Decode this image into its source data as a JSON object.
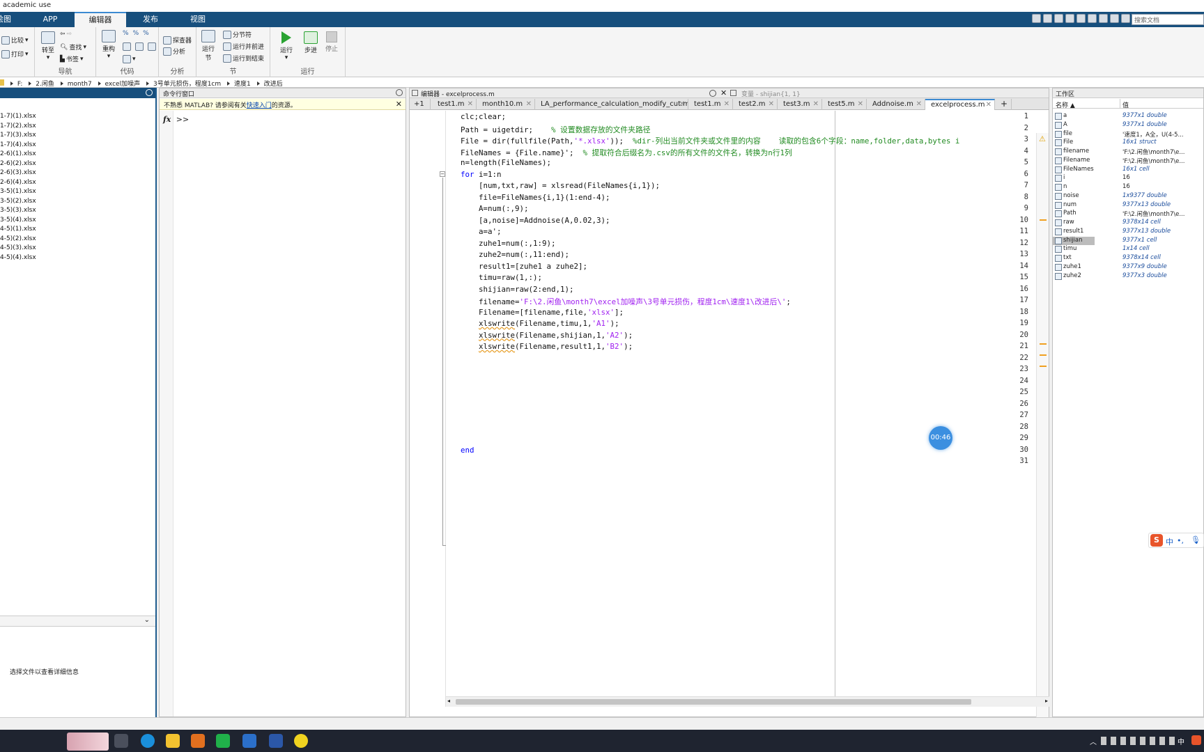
{
  "window": {
    "title": "academic use"
  },
  "ribbon_tabs": [
    {
      "label": "绘图"
    },
    {
      "label": "APP"
    },
    {
      "label": "编辑器"
    },
    {
      "label": "发布"
    },
    {
      "label": "视图"
    }
  ],
  "search": {
    "placeholder": "搜索文档"
  },
  "ribbon": {
    "compare": "比较",
    "print": "打印",
    "goto": "转至",
    "find": "查找",
    "bookmark": "书签",
    "nav_group": "导航",
    "refactor": "重构",
    "code_group": "代码",
    "profiler": "探查器",
    "analyze": "分析",
    "analyze_group": "分析",
    "run_section": "运行\n节",
    "section_break": "分节符",
    "run_and_advance": "运行并前进",
    "run_to_end": "运行到结束",
    "section_group": "节",
    "run": "运行",
    "step": "步进",
    "stop": "停止",
    "run_group": "运行"
  },
  "address": {
    "crumbs": [
      "F:",
      "2.闲鱼",
      "month7",
      "excel加噪声",
      "3号单元损伤，程度1cm",
      "速度1",
      "改进后"
    ]
  },
  "files": [
    "1-7)(1).xlsx",
    "1-7)(2).xlsx",
    "1-7)(3).xlsx",
    "1-7)(4).xlsx",
    "2-6)(1).xlsx",
    "2-6)(2).xlsx",
    "2-6)(3).xlsx",
    "2-6)(4).xlsx",
    "3-5)(1).xlsx",
    "3-5)(2).xlsx",
    "3-5)(3).xlsx",
    "3-5)(4).xlsx",
    "4-5)(1).xlsx",
    "4-5)(2).xlsx",
    "4-5)(3).xlsx",
    "4-5)(4).xlsx"
  ],
  "details": {
    "hint": "选择文件以查看详细信息"
  },
  "command_window": {
    "title": "命令行窗口",
    "notice_prefix": "不熟悉 MATLAB? 请参阅有关",
    "notice_link": "快速入门",
    "notice_suffix": "的资源。",
    "fx": "fx",
    "prompt": ">>"
  },
  "editor": {
    "title": "编辑器 - excelprocess.m",
    "variable_title": "变量 - shijian{1, 1}",
    "tab_counter": "+1",
    "tabs": [
      "test1.m",
      "month10.m",
      "LA_performance_calculation_modify_cut.m",
      "test1.m",
      "test2.m",
      "test3.m",
      "test5.m",
      "Addnoise.m",
      "excelprocess.m"
    ],
    "add_tab": "+",
    "line_numbers": [
      "1",
      "2",
      "3",
      "4",
      "5",
      "6",
      "7",
      "8",
      "9",
      "10",
      "11",
      "12",
      "13",
      "14",
      "15",
      "16",
      "17",
      "18",
      "19",
      "20",
      "21",
      "22",
      "23",
      "24",
      "25",
      "26",
      "27",
      "28",
      "29",
      "30",
      "31"
    ],
    "code": {
      "l1": "clc;clear;",
      "l2a": "Path = uigetdir;    ",
      "l2c": "% 设置数据存放的文件夹路径",
      "l3a": "File = dir(fullfile(Path,",
      "l3s": "'*.xlsx'",
      "l3b": "));  ",
      "l3c": "%dir-列出当前文件夹或文件里的内容    读取的包含6个字段：name,folder,data,bytes i",
      "l4a": "FileNames = {File.name}';  ",
      "l4c": "% 提取符合后缀名为.csv的所有文件的文件名，转换为n行1列",
      "l5": "n=length(FileNames);",
      "l6k": "for",
      "l6b": " i=1:n",
      "l7": "    [num,txt,raw] = xlsread(FileNames{i,1});",
      "l8": "    file=FileNames{i,1}(1:end-4);",
      "l9": "    A=num(:,9);",
      "l10": "    [a,noise]=Addnoise(A,0.02,3);",
      "l11": "    a=a';",
      "l12": "    zuhe1=num(:,1:9);",
      "l13": "    zuhe2=num(:,11:end);",
      "l14": "    result1=[zuhe1 a zuhe2];",
      "l15": "    timu=raw(1,:);",
      "l16": "    shijian=raw(2:end,1);",
      "l17a": "    filename=",
      "l17s": "'F:\\2.闲鱼\\month7\\excel加噪声\\3号单元损伤，程度1cm\\速度1\\改进后\\'",
      "l17b": ";",
      "l18a": "    Filename=[filename,file,",
      "l18s": "'xlsx'",
      "l18b": "];",
      "l19f": "xlswrite",
      "l19a": "(Filename,timu,1,",
      "l19s": "'A1'",
      "l19b": ");",
      "l20f": "xlswrite",
      "l20a": "(Filename,shijian,1,",
      "l20s": "'A2'",
      "l20b": ");",
      "l21f": "xlswrite",
      "l21a": "(Filename,result1,1,",
      "l21s": "'B2'",
      "l21b": ");",
      "l30": "end"
    }
  },
  "workspace": {
    "title": "工作区",
    "col_name": "名称 ▲",
    "col_value": "值",
    "rows": [
      {
        "name": "a",
        "value": "9377x1 double"
      },
      {
        "name": "A",
        "value": "9377x1 double"
      },
      {
        "name": "file",
        "value": "'速度1，A全，U(4-5..."
      },
      {
        "name": "File",
        "value": "16x1 struct"
      },
      {
        "name": "filename",
        "value": "'F:\\2.闲鱼\\month7\\e..."
      },
      {
        "name": "Filename",
        "value": "'F:\\2.闲鱼\\month7\\e..."
      },
      {
        "name": "FileNames",
        "value": "16x1 cell"
      },
      {
        "name": "i",
        "value": "16"
      },
      {
        "name": "n",
        "value": "16"
      },
      {
        "name": "noise",
        "value": "1x9377 double"
      },
      {
        "name": "num",
        "value": "9377x13 double"
      },
      {
        "name": "Path",
        "value": "'F:\\2.闲鱼\\month7\\e..."
      },
      {
        "name": "raw",
        "value": "9378x14 cell"
      },
      {
        "name": "result1",
        "value": "9377x13 double"
      },
      {
        "name": "shijian",
        "value": "9377x1 cell"
      },
      {
        "name": "timu",
        "value": "1x14 cell"
      },
      {
        "name": "txt",
        "value": "9378x14 cell"
      },
      {
        "name": "zuhe1",
        "value": "9377x9 double"
      },
      {
        "name": "zuhe2",
        "value": "9377x3 double"
      }
    ]
  },
  "overlay": {
    "timer": "00:46",
    "ime_lang": "中",
    "ime_mode": "•,",
    "ime_logo": "S"
  },
  "tray": {
    "ime": "中"
  },
  "colors": {
    "ribbon_blue": "#174f7d",
    "accent": "#3c8ad1",
    "keyword": "#0000ff",
    "comment": "#228b22",
    "string": "#a020f0"
  }
}
